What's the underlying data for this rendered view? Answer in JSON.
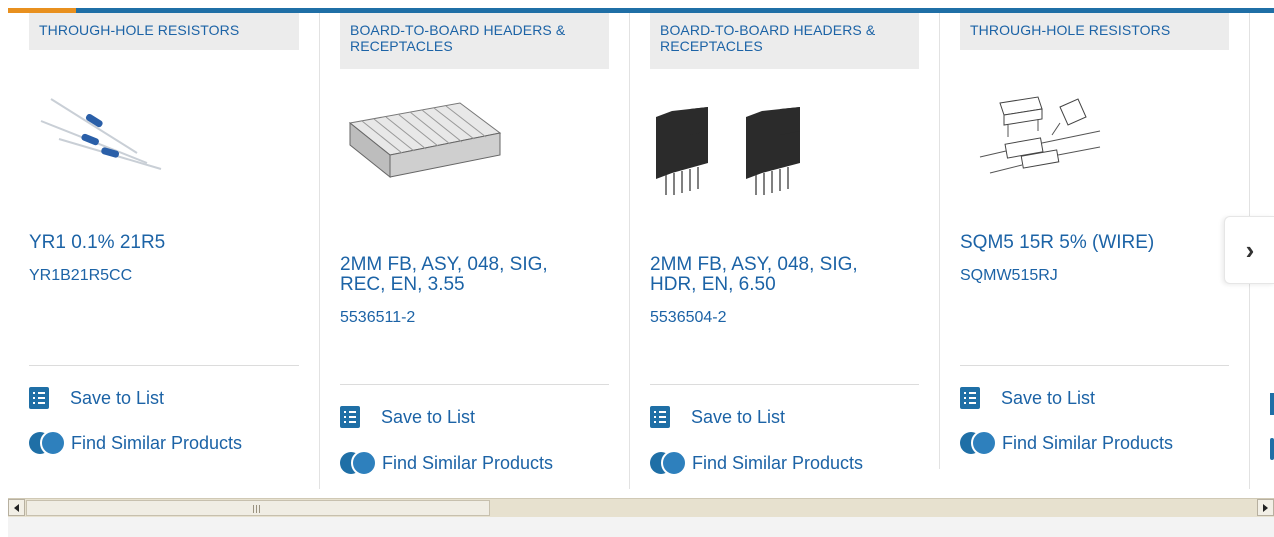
{
  "colors": {
    "brand_blue": "#1f6fa6",
    "link_blue": "#1c63a6",
    "accent_orange": "#e8901f",
    "category_bg": "#ececec"
  },
  "products": [
    {
      "category": "THROUGH-HOLE RESISTORS",
      "title": "YR1 0.1% 21R5",
      "part_number": "YR1B21R5CC",
      "save_label": "Save to List",
      "similar_label": "Find Similar Products"
    },
    {
      "category": "BOARD-TO-BOARD HEADERS & RECEPTACLES",
      "title": "2MM FB, ASY, 048, SIG, REC, EN, 3.55",
      "part_number": "5536511-2",
      "save_label": "Save to List",
      "similar_label": "Find Similar Products"
    },
    {
      "category": "BOARD-TO-BOARD HEADERS & RECEPTACLES",
      "title": "2MM FB, ASY, 048, SIG, HDR, EN, 6.50",
      "part_number": "5536504-2",
      "save_label": "Save to List",
      "similar_label": "Find Similar Products"
    },
    {
      "category": "THROUGH-HOLE RESISTORS",
      "title": "SQM5 15R 5% (WIRE)",
      "part_number": "SQMW515RJ",
      "save_label": "Save to List",
      "similar_label": "Find Similar Products"
    }
  ],
  "carousel": {
    "next_icon": "chevron-right-icon",
    "next_glyph": "›"
  },
  "scrollbar": {
    "left_icon": "scroll-left-icon",
    "right_icon": "scroll-right-icon"
  }
}
